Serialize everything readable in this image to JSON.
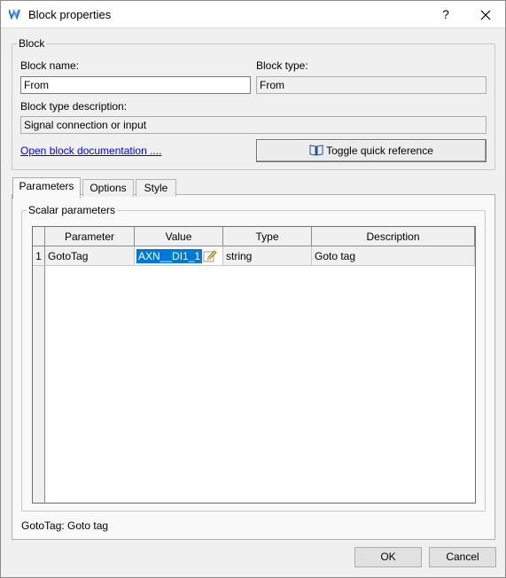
{
  "window": {
    "title": "Block properties",
    "help_label": "?",
    "close_label": "✕"
  },
  "block_group": {
    "legend": "Block",
    "name_label": "Block name:",
    "name_value": "From",
    "type_label": "Block type:",
    "type_value": "From",
    "description_label": "Block type description:",
    "description_value": "Signal connection or input",
    "doc_link": "Open block documentation ....",
    "quick_ref_button": "Toggle quick reference",
    "quick_ref_icon": "book-icon"
  },
  "tabs": [
    {
      "label": "Parameters",
      "active": true
    },
    {
      "label": "Options",
      "active": false
    },
    {
      "label": "Style",
      "active": false
    }
  ],
  "scalar_group": {
    "legend": "Scalar parameters",
    "columns": [
      "Parameter",
      "Value",
      "Type",
      "Description"
    ],
    "rows": [
      {
        "index": "1",
        "parameter": "GotoTag",
        "value": "AXN__DI1_1",
        "type": "string",
        "description": "Goto tag"
      }
    ],
    "edit_icon": "pencil-icon"
  },
  "status_text": "GotoTag: Goto tag",
  "buttons": {
    "ok": "OK",
    "cancel": "Cancel"
  },
  "colors": {
    "selection": "#0078d7",
    "link": "#0000ee",
    "brand_icon": "#2a6fd6"
  }
}
